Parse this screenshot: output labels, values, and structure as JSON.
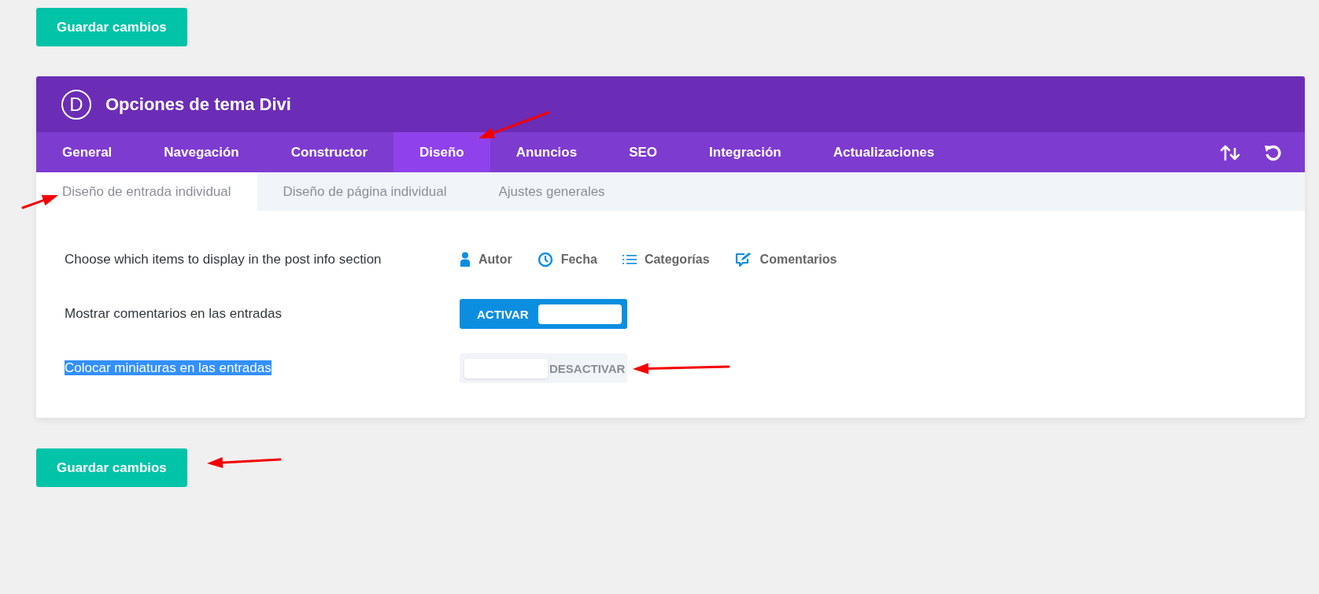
{
  "save_button_top": "Guardar cambios",
  "panel": {
    "logo": "D",
    "title": "Opciones de tema Divi"
  },
  "tabs": [
    {
      "label": "General",
      "selected": false
    },
    {
      "label": "Navegación",
      "selected": false
    },
    {
      "label": "Constructor",
      "selected": false
    },
    {
      "label": "Diseño",
      "selected": true
    },
    {
      "label": "Anuncios",
      "selected": false
    },
    {
      "label": "SEO",
      "selected": false
    },
    {
      "label": "Integración",
      "selected": false
    },
    {
      "label": "Actualizaciones",
      "selected": false
    }
  ],
  "subtabs": [
    {
      "label": "Diseño de entrada individual",
      "selected": true
    },
    {
      "label": "Diseño de página individual",
      "selected": false
    },
    {
      "label": "Ajustes generales",
      "selected": false
    }
  ],
  "settings": [
    {
      "kind": "post_info",
      "label": "Choose which items to display in the post info section",
      "highlighted": false,
      "options": [
        {
          "kind": "author",
          "label": "Autor"
        },
        {
          "kind": "date",
          "label": "Fecha"
        },
        {
          "kind": "categories",
          "label": "Categorías"
        },
        {
          "kind": "comments",
          "label": "Comentarios"
        }
      ]
    },
    {
      "kind": "toggle",
      "label": "Mostrar comentarios en las entradas",
      "highlighted": false,
      "on": true,
      "text": "ACTIVAR"
    },
    {
      "kind": "toggle",
      "label": "Colocar miniaturas en las entradas",
      "highlighted": true,
      "on": false,
      "text": "DESACTIVAR"
    }
  ],
  "save_button_bottom": "Guardar cambios"
}
